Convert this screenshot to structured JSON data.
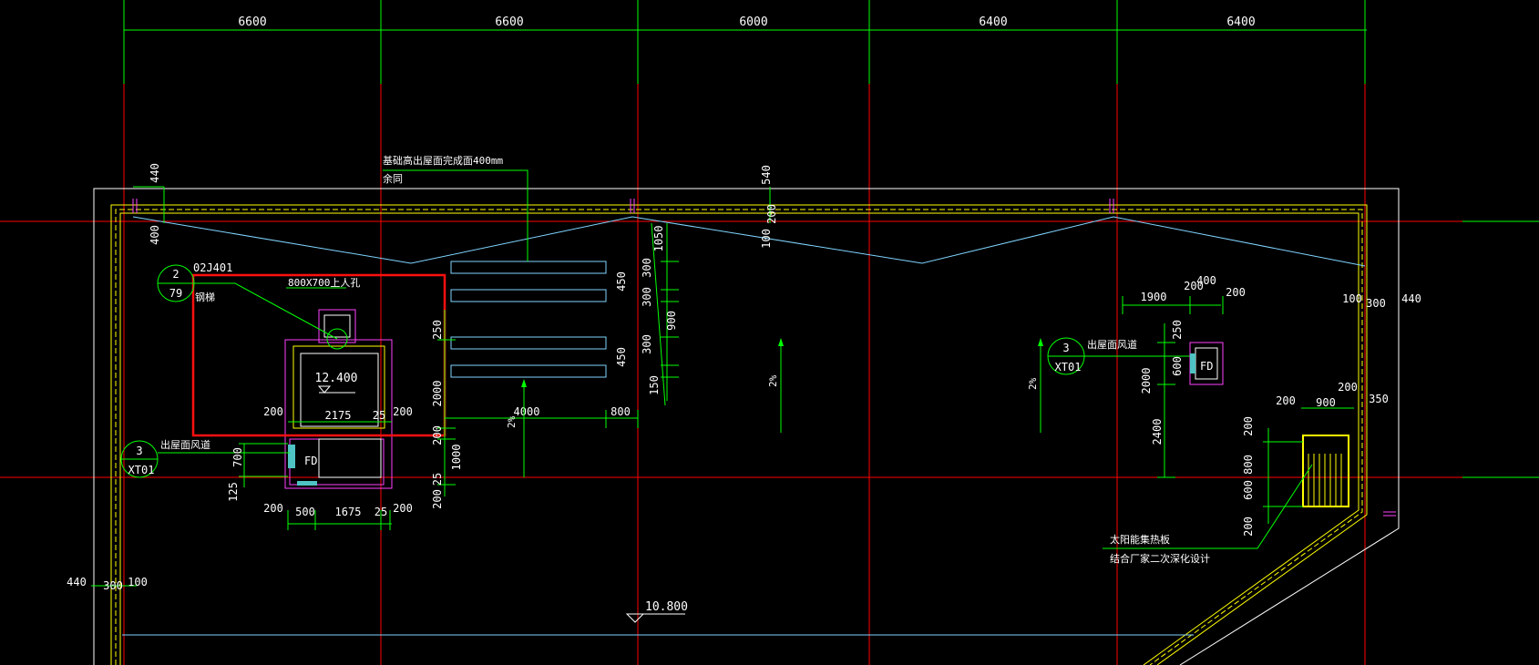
{
  "top_dimensions": [
    "6600",
    "6600",
    "6000",
    "6400",
    "6400"
  ],
  "notes": {
    "foundation_line1": "基础高出屋面完成面400mm",
    "foundation_line2": "余同",
    "ref_num": "2",
    "ref_page": "79",
    "ref_std": "02J401",
    "ladder": "钢梯",
    "hatch": "800X700上人孔",
    "duct": "出屋面风道",
    "xt_num": "3",
    "xt_code": "XT01",
    "fd": "FD",
    "solar1": "太阳能集热板",
    "solar2": "结合厂家二次深化设计"
  },
  "elevations": {
    "stair": "12.400",
    "roof": "10.800"
  },
  "slopes": {
    "s1": "2%",
    "s2": "2%",
    "s3": "2%"
  },
  "dims": {
    "d440a": "440",
    "d400a": "400",
    "d540": "540",
    "d200a": "200",
    "d100a": "100",
    "d1050": "1050",
    "d300a": "300",
    "d300b": "300",
    "d900a": "900",
    "d300c": "300",
    "d150": "150",
    "d450a": "450",
    "d450b": "450",
    "d250a": "250",
    "d2000a": "2000",
    "d200b": "200",
    "d1000": "1000",
    "d200c": "200",
    "d25a": "25",
    "d4000": "4000",
    "d800a": "800",
    "d200d": "200",
    "d2175": "2175",
    "d25b": "25",
    "d200e": "200",
    "d700": "700",
    "d125": "125",
    "d200f": "200",
    "d500": "500",
    "d1675": "1675",
    "d25c": "25",
    "d200g": "200",
    "d440b": "440",
    "d300d": "300",
    "d100b": "100",
    "d1900": "1900",
    "d200h": "200",
    "d400b": "400",
    "d200i": "200",
    "d250b": "250",
    "d600": "600",
    "d2000b": "2000",
    "d2400": "2400",
    "d100c": "100",
    "d300e": "300",
    "d440c": "440",
    "d200j": "200",
    "d900b": "900",
    "d200k": "200",
    "d350": "350",
    "d200l": "200",
    "d800b": "800",
    "d600b": "600",
    "d200m": "200"
  }
}
